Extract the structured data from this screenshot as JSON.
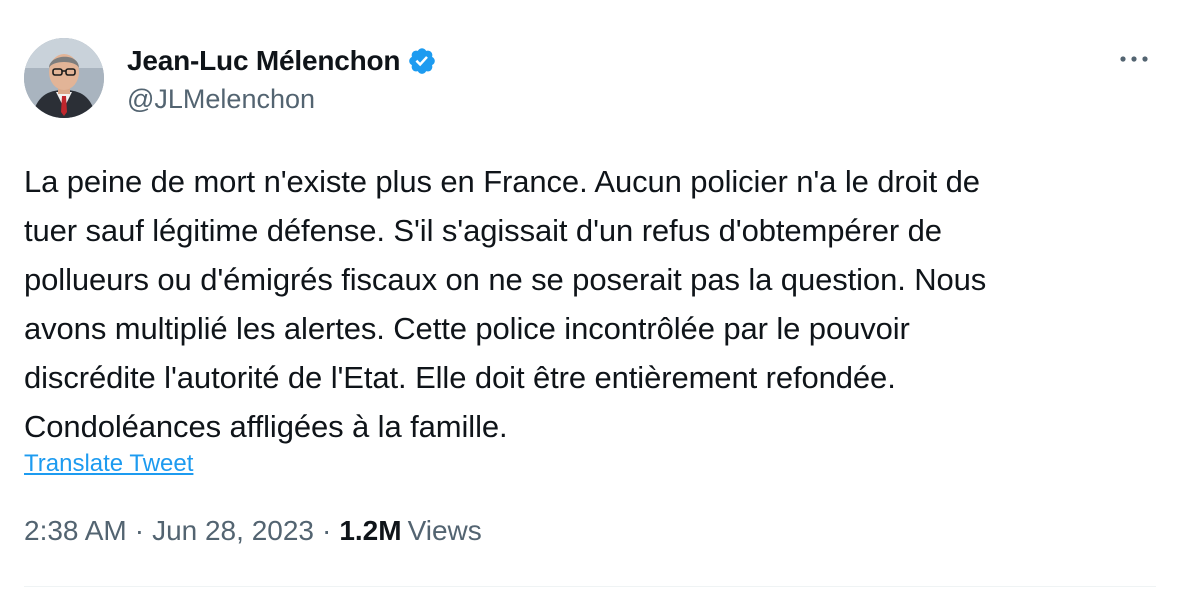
{
  "author": {
    "display_name": "Jean-Luc Mélenchon",
    "handle": "@JLMelenchon",
    "verified_icon": "verified-badge-icon"
  },
  "menu": {
    "more_icon": "more-horizontal-icon"
  },
  "tweet": {
    "text": "La peine de mort n'existe plus en France. Aucun policier n'a le droit de\ntuer sauf légitime défense. S'il s'agissait d'un refus d'obtempérer de\npollueurs ou d'émigrés fiscaux on ne se poserait pas la question. Nous\navons multiplié les alertes. Cette police incontrôlée par le pouvoir\ndiscrédite l'autorité de l'Etat. Elle doit être entièrement refondée.\nCondoléances affligées à la famille.",
    "translate_label": "Translate Tweet",
    "time": "2:38 AM",
    "date": "Jun 28, 2023",
    "separator": "·",
    "views_count": "1.2M",
    "views_label": "Views"
  },
  "colors": {
    "accent": "#1d9bf0",
    "text_primary": "#0f1419",
    "text_secondary": "#536471",
    "divider": "#eff3f4"
  }
}
